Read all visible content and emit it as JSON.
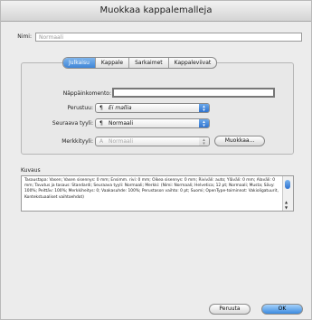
{
  "window": {
    "title": "Muokkaa kappalemalleja"
  },
  "name": {
    "label": "Nimi:",
    "value": "Normaali"
  },
  "tabs": [
    {
      "label": "Julkaisu",
      "active": true
    },
    {
      "label": "Kappale",
      "active": false
    },
    {
      "label": "Sarkaimet",
      "active": false
    },
    {
      "label": "Kappaleviivat",
      "active": false
    }
  ],
  "form": {
    "shortcut_label": "Näppäinkomento:",
    "shortcut_value": "",
    "based_on_label": "Perustuu:",
    "based_on_value": "Ei mallia",
    "next_style_label": "Seuraava tyyli:",
    "next_style_value": "Normaali",
    "char_style_label": "Merkkityyli:",
    "char_style_value": "Normaali",
    "edit_button": "Muokkaa..."
  },
  "description": {
    "label": "Kuvaus",
    "text": "Tasaustapa: Vasen; Vasen sisennys: 0 mm; Ensimm. rivi: 0 mm; Oikea sisennys: 0 mm; Riviväli: auto; Yläväli: 0 mm; Alaväli: 0 mm; Tavutus ja tasaus: Standardi; Seuraava tyyli: Normaali; Merkki: (Nimi: Normaali; Helvetica; 12 pt; Normaali; Musta; Sävy: 100%; Peittäv: 100%; Merkkiheitys: 0; Vaakasuhde: 100%; Perustason vaihto: 0 pt; Suomi; OpenType-toiminnot: Vakioligatuurit, Kontekstuaaliset vaihtoehdot)"
  },
  "buttons": {
    "cancel": "Peruuta",
    "ok": "OK"
  }
}
